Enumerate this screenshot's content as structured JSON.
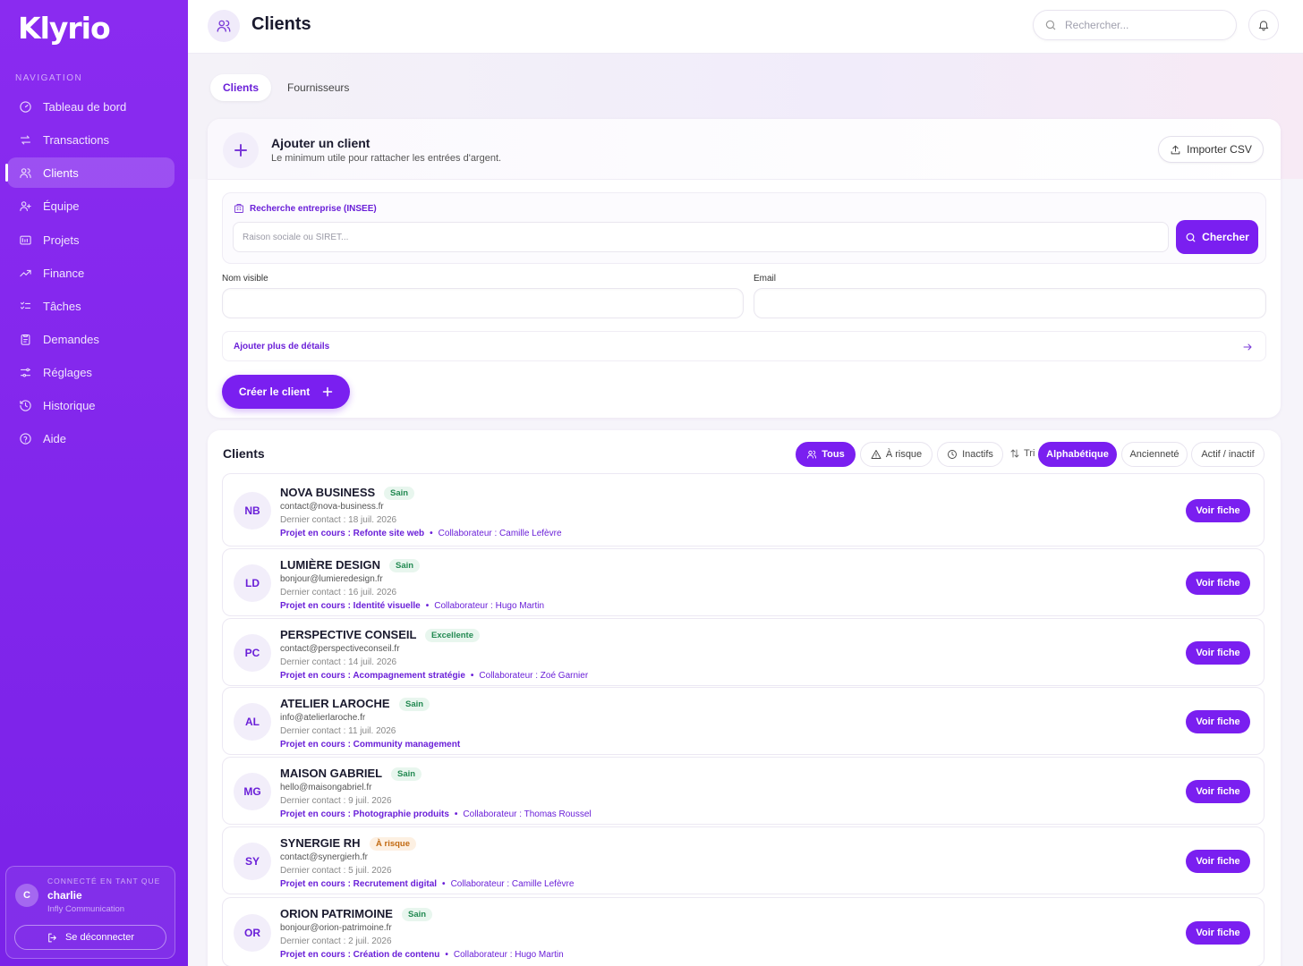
{
  "app": {
    "logo": "Klyrio"
  },
  "sidebar": {
    "nav_title": "NAVIGATION",
    "items": [
      {
        "label": "Tableau de bord",
        "icon": "gauge-icon"
      },
      {
        "label": "Transactions",
        "icon": "arrows-icon"
      },
      {
        "label": "Clients",
        "icon": "users-icon",
        "active": true
      },
      {
        "label": "Équipe",
        "icon": "team-icon"
      },
      {
        "label": "Projets",
        "icon": "folder-icon"
      },
      {
        "label": "Finance",
        "icon": "trend-icon"
      },
      {
        "label": "Tâches",
        "icon": "checklist-icon"
      },
      {
        "label": "Demandes",
        "icon": "clipboard-icon"
      },
      {
        "label": "Réglages",
        "icon": "sliders-icon"
      },
      {
        "label": "Historique",
        "icon": "history-icon"
      },
      {
        "label": "Aide",
        "icon": "help-icon"
      }
    ],
    "user": {
      "label": "CONNECTÉ EN TANT QUE",
      "initial": "C",
      "name": "charlie",
      "org": "Infly Communication",
      "logout": "Se déconnecter"
    }
  },
  "header": {
    "title": "Clients",
    "search_placeholder": "Rechercher..."
  },
  "tabs": [
    {
      "label": "Clients",
      "active": true
    },
    {
      "label": "Fournisseurs",
      "active": false
    }
  ],
  "add_client": {
    "title": "Ajouter un client",
    "subtitle": "Le minimum utile pour rattacher les entrées d'argent.",
    "import_label": "Importer CSV",
    "insee_label": "Recherche entreprise (INSEE)",
    "insee_placeholder": "Raison sociale ou SIRET...",
    "search_label": "Chercher",
    "name_label": "Nom visible",
    "email_label": "Email",
    "more_details": "Ajouter plus de détails",
    "create_label": "Créer le client"
  },
  "clients_list": {
    "title": "Clients",
    "filters": [
      {
        "label": "Tous",
        "active": true
      },
      {
        "label": "À risque",
        "active": false
      },
      {
        "label": "Inactifs",
        "active": false
      }
    ],
    "sort_label": "Tri",
    "sorts": [
      {
        "label": "Alphabétique",
        "active": true
      },
      {
        "label": "Ancienneté",
        "active": false
      },
      {
        "label": "Actif / inactif",
        "active": false
      }
    ],
    "view_label": "Voir fiche",
    "rows": [
      {
        "initials": "NB",
        "name": "NOVA BUSINESS",
        "status": "Sain",
        "status_type": "sain",
        "email": "contact@nova-business.fr",
        "last": "Dernier contact : 18 juil. 2026",
        "project": "Projet en cours : Refonte site web",
        "collab": "Collaborateur : Camille Lefèvre"
      },
      {
        "initials": "LD",
        "name": "LUMIÈRE DESIGN",
        "status": "Sain",
        "status_type": "sain",
        "email": "bonjour@lumieredesign.fr",
        "last": "Dernier contact : 16 juil. 2026",
        "project": "Projet en cours : Identité visuelle",
        "collab": "Collaborateur : Hugo Martin"
      },
      {
        "initials": "PC",
        "name": "PERSPECTIVE CONSEIL",
        "status": "Excellente",
        "status_type": "excellente",
        "email": "contact@perspectiveconseil.fr",
        "last": "Dernier contact : 14 juil. 2026",
        "project": "Projet en cours : Acompagnement stratégie",
        "collab": "Collaborateur : Zoé Garnier"
      },
      {
        "initials": "AL",
        "name": "ATELIER LAROCHE",
        "status": "Sain",
        "status_type": "sain",
        "email": "info@atelierlaroche.fr",
        "last": "Dernier contact : 11 juil. 2026",
        "project": "Projet en cours : Community management",
        "collab": ""
      },
      {
        "initials": "MG",
        "name": "MAISON GABRIEL",
        "status": "Sain",
        "status_type": "sain",
        "email": "hello@maisongabriel.fr",
        "last": "Dernier contact : 9 juil. 2026",
        "project": "Projet en cours : Photographie produits",
        "collab": "Collaborateur : Thomas Roussel"
      },
      {
        "initials": "SY",
        "name": "SYNERGIE RH",
        "status": "À risque",
        "status_type": "risque",
        "email": "contact@synergierh.fr",
        "last": "Dernier contact : 5 juil. 2026",
        "project": "Projet en cours : Recrutement digital",
        "collab": "Collaborateur : Camille Lefèvre"
      },
      {
        "initials": "OR",
        "name": "ORION PATRIMOINE",
        "status": "Sain",
        "status_type": "sain",
        "email": "bonjour@orion-patrimoine.fr",
        "last": "Dernier contact : 2 juil. 2026",
        "project": "Projet en cours : Création de contenu",
        "collab": "Collaborateur : Hugo Martin"
      }
    ]
  },
  "colors": {
    "accent": "#7a1ff0",
    "sidebar": "#8a2bf0",
    "healthy": "#238a52",
    "risk": "#c26a12"
  }
}
